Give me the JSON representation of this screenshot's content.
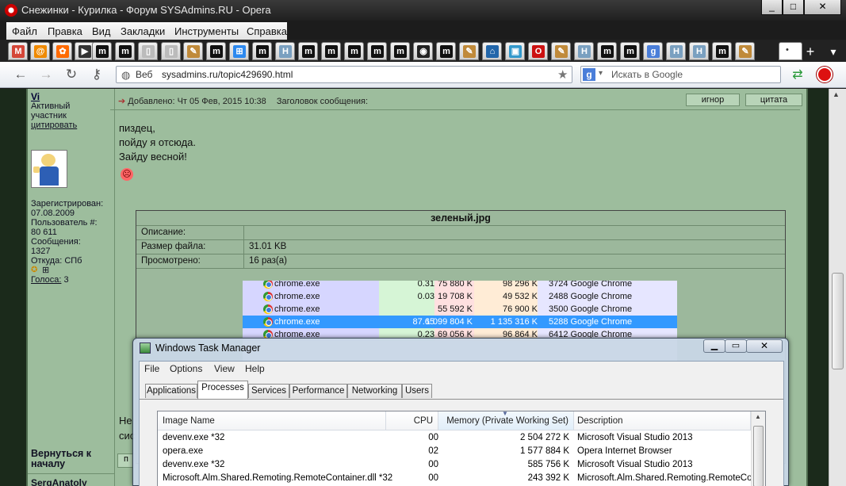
{
  "window": {
    "title": "Снежинки - Курилка - Форум SYSAdmins.RU - Opera",
    "controls": {
      "minimize": "_",
      "maximize": "□",
      "close": "✕"
    }
  },
  "menu": [
    "Файл",
    "Правка",
    "Вид",
    "Закладки",
    "Инструменты",
    "Справка"
  ],
  "tabs": [
    {
      "icon": "gmail-icon",
      "glyph": "M",
      "color": "#d44638"
    },
    {
      "icon": "mail-icon",
      "glyph": "@",
      "color": "#f08a00"
    },
    {
      "icon": "paw-icon",
      "glyph": "✿",
      "color": "#ff6a00"
    },
    {
      "icon": "arrow-icon",
      "glyph": "▶",
      "color": "#333333"
    },
    {
      "icon": "m-icon",
      "glyph": "m",
      "color": "#111111"
    },
    {
      "icon": "m-icon",
      "glyph": "m",
      "color": "#111111"
    },
    {
      "icon": "page-icon",
      "glyph": "▯",
      "color": "#bbbbbb"
    },
    {
      "icon": "page-icon",
      "glyph": "▯",
      "color": "#bbbbbb"
    },
    {
      "icon": "pencil-icon",
      "glyph": "✎",
      "color": "#c08a3a"
    },
    {
      "icon": "m-icon",
      "glyph": "m",
      "color": "#111111"
    },
    {
      "icon": "windows-icon",
      "glyph": "⊞",
      "color": "#2d89ef"
    },
    {
      "icon": "m-icon",
      "glyph": "m",
      "color": "#111111"
    },
    {
      "icon": "h-icon",
      "glyph": "H",
      "color": "#7aa0c0"
    },
    {
      "icon": "m-icon",
      "glyph": "m",
      "color": "#111111"
    },
    {
      "icon": "m-icon",
      "glyph": "m",
      "color": "#111111"
    },
    {
      "icon": "m-icon",
      "glyph": "m",
      "color": "#111111"
    },
    {
      "icon": "m-icon",
      "glyph": "m",
      "color": "#111111"
    },
    {
      "icon": "m-icon",
      "glyph": "m",
      "color": "#111111"
    },
    {
      "icon": "github-icon",
      "glyph": "◉",
      "color": "#222222"
    },
    {
      "icon": "m-icon",
      "glyph": "m",
      "color": "#111111"
    },
    {
      "icon": "pencil-icon",
      "glyph": "✎",
      "color": "#c08a3a"
    },
    {
      "icon": "house-icon",
      "glyph": "⌂",
      "color": "#2266aa"
    },
    {
      "icon": "picture-icon",
      "glyph": "▣",
      "color": "#3399cc"
    },
    {
      "icon": "opera-icon",
      "glyph": "O",
      "color": "#cc1111"
    },
    {
      "icon": "pencil-icon",
      "glyph": "✎",
      "color": "#c08a3a"
    },
    {
      "icon": "h-icon",
      "glyph": "H",
      "color": "#7aa0c0"
    },
    {
      "icon": "m-icon",
      "glyph": "m",
      "color": "#111111"
    },
    {
      "icon": "m-icon",
      "glyph": "m",
      "color": "#111111"
    },
    {
      "icon": "google-icon",
      "glyph": "g",
      "color": "#4a7ed9"
    },
    {
      "icon": "h-icon",
      "glyph": "H",
      "color": "#7aa0c0"
    },
    {
      "icon": "h-icon",
      "glyph": "H",
      "color": "#7aa0c0"
    },
    {
      "icon": "m-icon",
      "glyph": "m",
      "color": "#111111"
    },
    {
      "icon": "pencil-icon",
      "glyph": "✎",
      "color": "#c08a3a"
    }
  ],
  "address": {
    "badge": "Веб",
    "url": "sysadmins.ru/topic429690.html",
    "search_placeholder": "Искать в Google",
    "search_engine_glyph": "g"
  },
  "user": {
    "name": "Vi",
    "status": "Активный участник",
    "quote_link": "цитировать",
    "registered_label": "Зарегистрирован:",
    "registered": "07.08.2009",
    "user_num_label": "Пользователь #:",
    "user_num": "80 611",
    "messages_label": "Сообщения:",
    "messages": "1327",
    "from_label": "Откуда:",
    "from": "СПб",
    "votes_label": "Голоса:",
    "votes": "3"
  },
  "post": {
    "added": "Добавлено: Чт 05 Фев, 2015 10:38",
    "subject_label": "Заголовок сообщения:",
    "ignore": "игнор",
    "quote": "цитата",
    "lines": [
      "пиздец,",
      "пойду я отсюда.",
      "Зайду весной!"
    ],
    "smiley": "☹"
  },
  "attachment": {
    "filename": "зеленый.jpg",
    "rows": [
      {
        "label": "Описание:",
        "value": ""
      },
      {
        "label": "Размер файла:",
        "value": "31.01 KB"
      },
      {
        "label": "Просмотрено:",
        "value": "16 раз(а)"
      }
    ]
  },
  "chrome_rows": [
    {
      "name": "chrome.exe",
      "cpu": "0.31",
      "ws": "75 880 K",
      "priv": "98 296 K",
      "desc": "3724 Google Chrome"
    },
    {
      "name": "chrome.exe",
      "cpu": "0.03",
      "ws": "19 708 K",
      "priv": "49 532 K",
      "desc": "2488 Google Chrome"
    },
    {
      "name": "chrome.exe",
      "cpu": "",
      "ws": "55 592 K",
      "priv": "76 900 K",
      "desc": "3500 Google Chrome"
    },
    {
      "name": "chrome.exe",
      "cpu": "87.65",
      "ws": "1 099 804 K",
      "priv": "1 135 316 K",
      "desc": "5288 Google Chrome",
      "selected": true
    },
    {
      "name": "chrome.exe",
      "cpu": "0.23",
      "ws": "69 056 K",
      "priv": "96 864 K",
      "desc": "6412 Google Chrome"
    }
  ],
  "forum_left": {
    "back_to_top": "Вернуться к началу",
    "partial_text_1": "Не",
    "partial_text_2": "сис",
    "partial_btn": "п",
    "partial_next": "SergAnatoly"
  },
  "taskmgr": {
    "title": "Windows Task Manager",
    "menu": [
      "File",
      "Options",
      "View",
      "Help"
    ],
    "tabs": [
      "Applications",
      "Processes",
      "Services",
      "Performance",
      "Networking",
      "Users"
    ],
    "selected_tab": "Processes",
    "columns": [
      "Image Name",
      "CPU",
      "Memory (Private Working Set)",
      "Description"
    ],
    "rows": [
      {
        "name": "devenv.exe *32",
        "cpu": "00",
        "mem": "2 504 272 K",
        "desc": "Microsoft Visual Studio 2013"
      },
      {
        "name": "opera.exe",
        "cpu": "02",
        "mem": "1 577 884 K",
        "desc": "Opera Internet Browser"
      },
      {
        "name": "devenv.exe *32",
        "cpu": "00",
        "mem": "585 756 K",
        "desc": "Microsoft Visual Studio 2013"
      },
      {
        "name": "Microsoft.Alm.Shared.Remoting.RemoteContainer.dll *32",
        "cpu": "00",
        "mem": "243 392 K",
        "desc": "Microsoft.Alm.Shared.Remoting.RemoteConta"
      }
    ]
  }
}
